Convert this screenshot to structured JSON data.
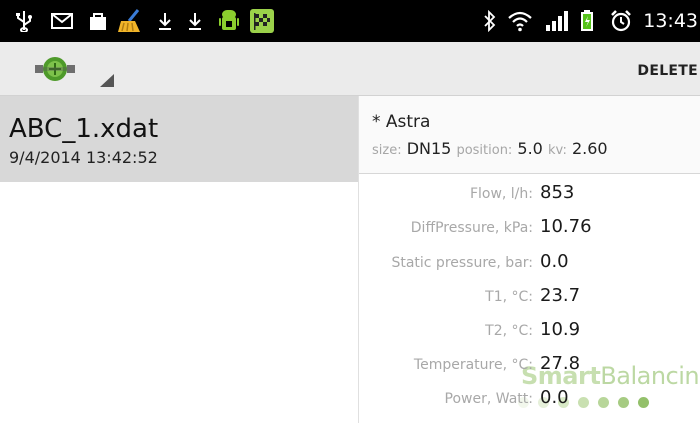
{
  "status_bar": {
    "time": "13:43",
    "icons": [
      "usb-icon",
      "mail-icon",
      "bag-icon",
      "broom-icon",
      "download-icon",
      "download-icon",
      "android-icon",
      "checkered-flag-icon",
      "bluetooth-icon",
      "wifi-icon",
      "signal-icon",
      "battery-icon",
      "alarm-icon"
    ]
  },
  "action_bar": {
    "app_icon": "valve-icon",
    "delete_label": "DELETE"
  },
  "file_list": [
    {
      "name": "ABC_1.xdat",
      "date": "9/4/2014 13:42:52"
    }
  ],
  "details": {
    "valve_name": "* Astra",
    "size_label": "size:",
    "size_value": "DN15",
    "position_label": "position:",
    "position_value": "5.0",
    "kv_label": "kv:",
    "kv_value": "2.60",
    "rows": [
      {
        "label": "Flow, l/h:",
        "value": "853"
      },
      {
        "label": "DiffPressure, kPa:",
        "value": "10.76"
      },
      {
        "label": "Static pressure, bar:",
        "value": "0.0"
      },
      {
        "label": "T1, °C:",
        "value": "23.7"
      },
      {
        "label": "T2, °C:",
        "value": "10.9"
      },
      {
        "label": "Temperature, °C:",
        "value": "27.8"
      },
      {
        "label": "Power, Watt:",
        "value": "0.0"
      }
    ]
  },
  "watermark": {
    "word1": "Smart",
    "word2": "Balancing",
    "dot_colors": [
      "#f2f7ec",
      "#e6f0da",
      "#d8e9c6",
      "#c9e0b1",
      "#b8d69a",
      "#a6cb82",
      "#93c06a"
    ]
  }
}
